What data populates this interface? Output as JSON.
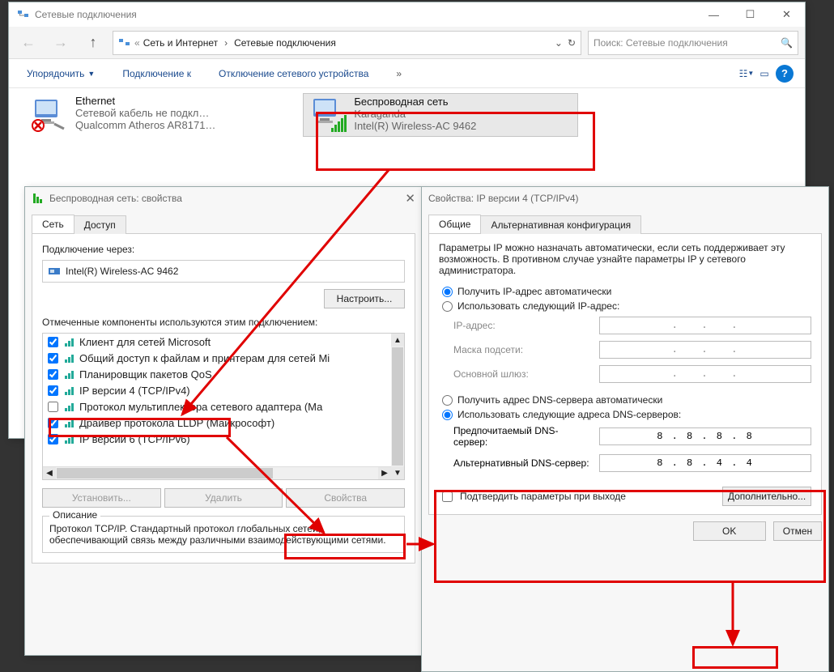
{
  "mainWindow": {
    "title": "Сетевые подключения",
    "breadcrumb": {
      "root": "Сеть и Интернет",
      "chev": "›",
      "leaf": "Сетевые подключения"
    },
    "searchPlaceholder": "Поиск: Сетевые подключения",
    "toolbar": {
      "organize": "Упорядочить",
      "connect": "Подключение к",
      "disable": "Отключение сетевого устройства",
      "rename": "»"
    },
    "ethernet": {
      "name": "Ethernet",
      "sub1": "Сетевой кабель не подкл…",
      "sub2": "Qualcomm Atheros AR8171…"
    },
    "wifi": {
      "name": "Беспроводная сеть",
      "sub1": "Karaganda",
      "sub2": "Intel(R) Wireless-AC 9462"
    }
  },
  "props": {
    "title": "Беспроводная сеть: свойства",
    "tabNetwork": "Сеть",
    "tabAccess": "Доступ",
    "connectVia": "Подключение через:",
    "adapter": "Intel(R) Wireless-AC 9462",
    "configure": "Настроить...",
    "componentsLabel": "Отмеченные компоненты используются этим подключением:",
    "components": [
      {
        "chk": true,
        "label": "Клиент для сетей Microsoft"
      },
      {
        "chk": true,
        "label": "Общий доступ к файлам и принтерам для сетей Mi"
      },
      {
        "chk": true,
        "label": "Планировщик пакетов QoS"
      },
      {
        "chk": true,
        "label": "IP версии 4 (TCP/IPv4)"
      },
      {
        "chk": false,
        "label": "Протокол мультиплексора сетевого адаптера (Ма"
      },
      {
        "chk": true,
        "label": "Драйвер протокола LLDP (Майкрософт)"
      },
      {
        "chk": true,
        "label": "IP версии 6 (TCP/IPv6)"
      }
    ],
    "install": "Установить...",
    "remove": "Удалить",
    "propBtn": "Свойства",
    "descLegend": "Описание",
    "desc": "Протокол TCP/IP. Стандартный протокол глобальных сетей, обеспечивающий связь между различными взаимодействующими сетями."
  },
  "ipv4": {
    "title": "Свойства: IP версии 4 (TCP/IPv4)",
    "tabGeneral": "Общие",
    "tabAlt": "Альтернативная конфигурация",
    "intro": "Параметры IP можно назначать автоматически, если сеть поддерживает эту возможность. В противном случае узнайте параметры IP у сетевого администратора.",
    "autoIp": "Получить IP-адрес автоматически",
    "manualIp": "Использовать следующий IP-адрес:",
    "ipAddr": "IP-адрес:",
    "mask": "Маска подсети:",
    "gateway": "Основной шлюз:",
    "autoDns": "Получить адрес DNS-сервера автоматически",
    "manualDns": "Использовать следующие адреса DNS-серверов:",
    "prefDns": "Предпочитаемый DNS-сервер:",
    "altDns": "Альтернативный DNS-сервер:",
    "prefDnsVal": "8 . 8 . 8 . 8",
    "altDnsVal": "8 . 8 . 4 . 4",
    "validate": "Подтвердить параметры при выходе",
    "advanced": "Дополнительно...",
    "ok": "OK",
    "cancel": "Отмен"
  }
}
